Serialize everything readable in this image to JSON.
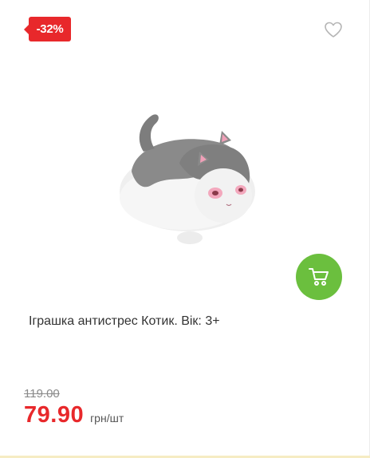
{
  "product": {
    "discount_badge": "-32%",
    "title": "Іграшка антистрес Котик. Вік: 3+",
    "old_price": "119.00",
    "price": "79.90",
    "unit": "грн/шт",
    "image_alt": "toy-cat-squishy"
  },
  "colors": {
    "badge": "#e8282b",
    "cart_button": "#6bbf3e",
    "price": "#e8282b"
  },
  "icons": {
    "favorite": "heart-outline-icon",
    "cart": "shopping-cart-icon"
  }
}
